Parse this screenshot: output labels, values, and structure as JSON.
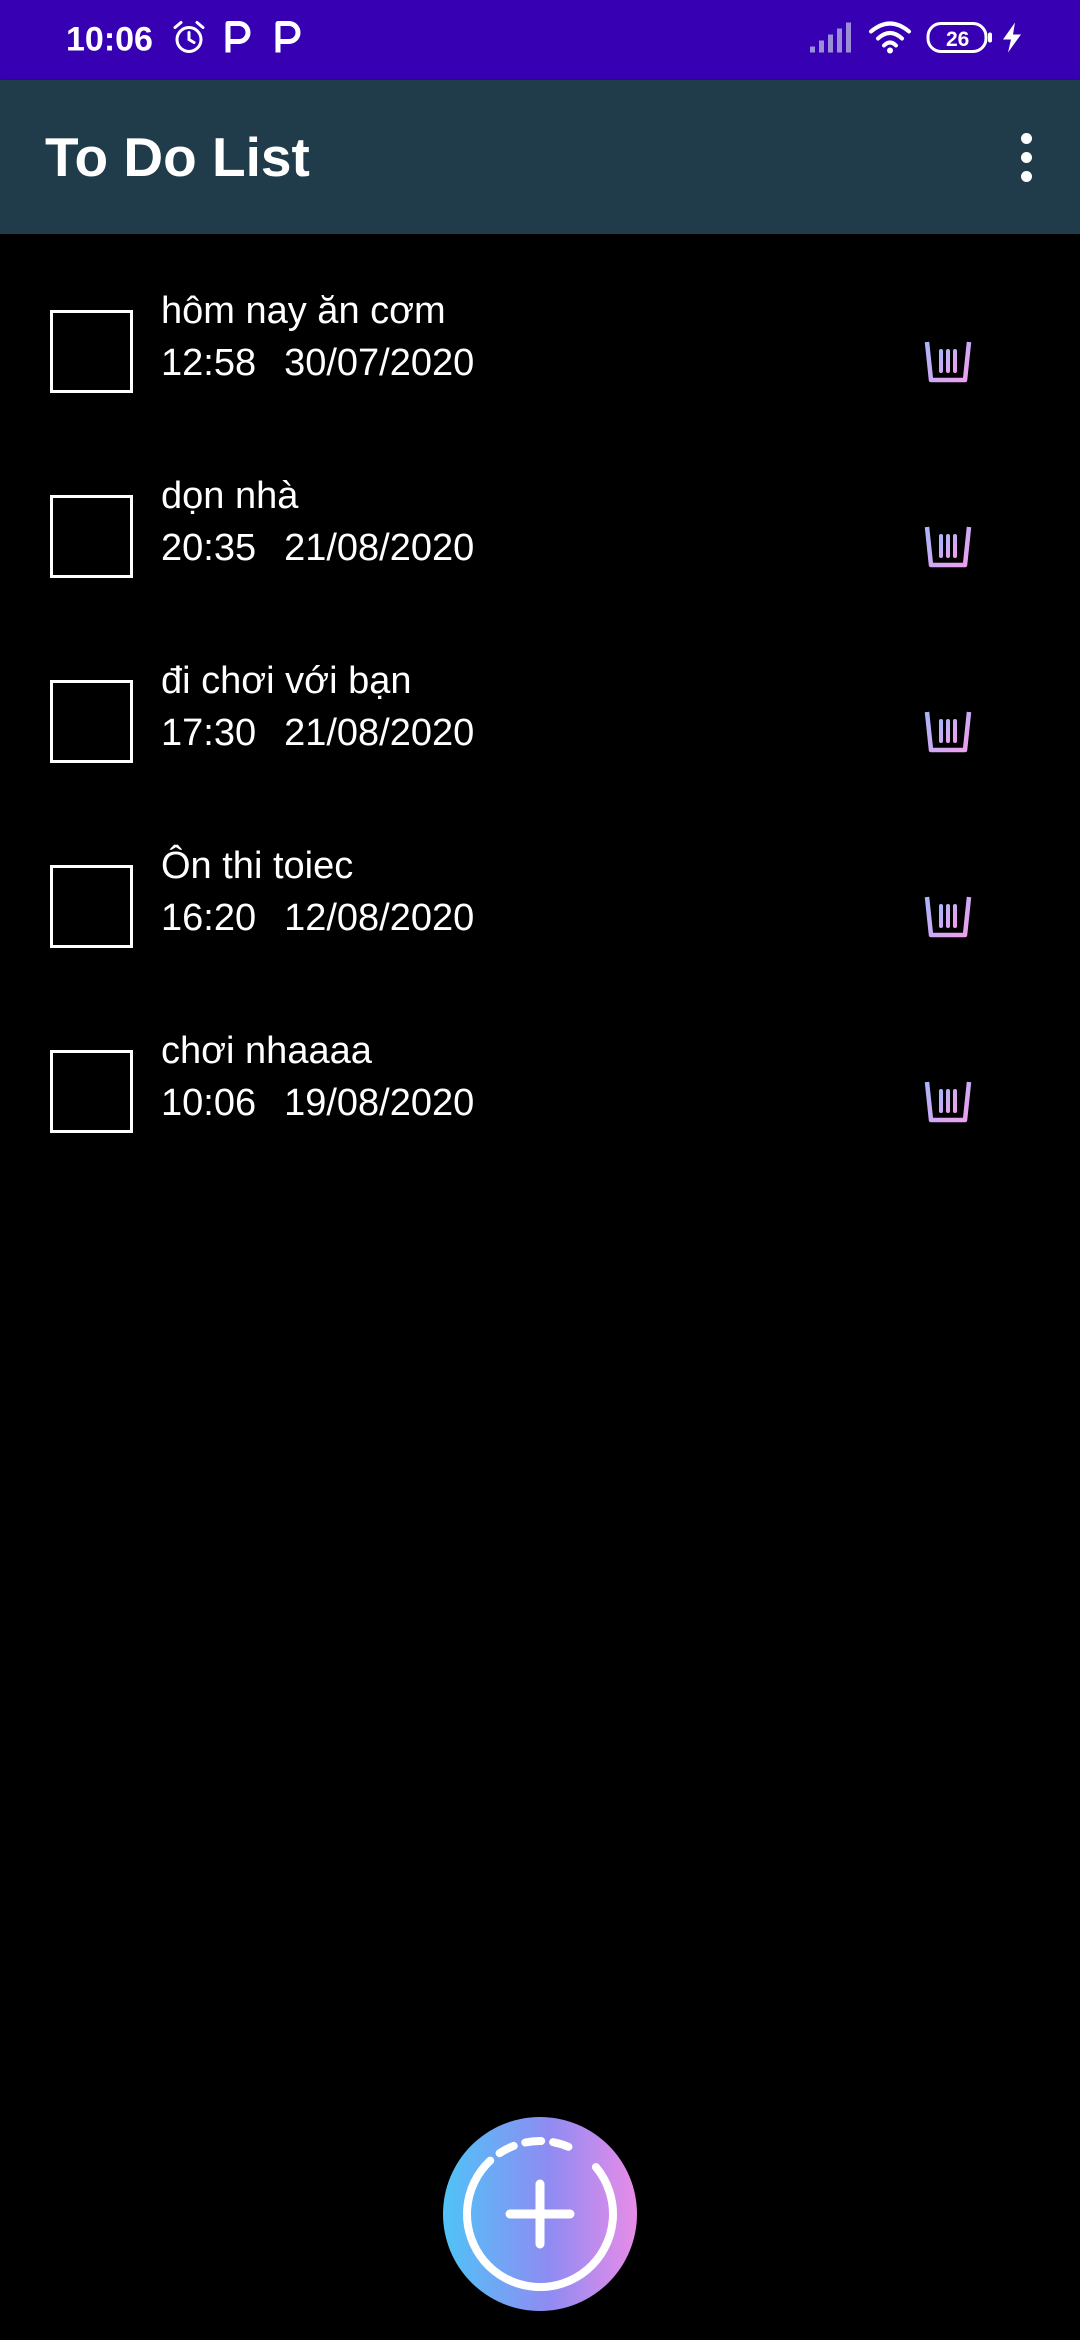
{
  "status_bar": {
    "time": "10:06",
    "battery": "26",
    "icons": [
      "alarm-icon",
      "p-app-icon",
      "p-app-icon",
      "signal-icon",
      "wifi-icon",
      "battery-icon",
      "charging-icon"
    ]
  },
  "app_bar": {
    "title": "To Do List",
    "menu_icon": "more-vert-icon"
  },
  "tasks": [
    {
      "title": "hôm nay ăn cơm",
      "time": "12:58",
      "date": "30/07/2020",
      "checked": false
    },
    {
      "title": "dọn nhà",
      "time": "20:35",
      "date": "21/08/2020",
      "checked": false
    },
    {
      "title": "đi chơi với bạn",
      "time": "17:30",
      "date": "21/08/2020",
      "checked": false
    },
    {
      "title": "Ôn thi toiec",
      "time": "16:20",
      "date": "12/08/2020",
      "checked": false
    },
    {
      "title": "chơi nhaaaa",
      "time": "10:06",
      "date": "19/08/2020",
      "checked": false
    }
  ],
  "fab": {
    "icon": "add-icon"
  },
  "colors": {
    "status_bar": "#3700b3",
    "app_bar": "#203c4a",
    "background": "#000000",
    "delete_icon_gradient": [
      "#b79cf5",
      "#e9a2f2"
    ],
    "fab_gradient": [
      "#4fc3f7",
      "#8f8bf2",
      "#e88ce8"
    ]
  }
}
